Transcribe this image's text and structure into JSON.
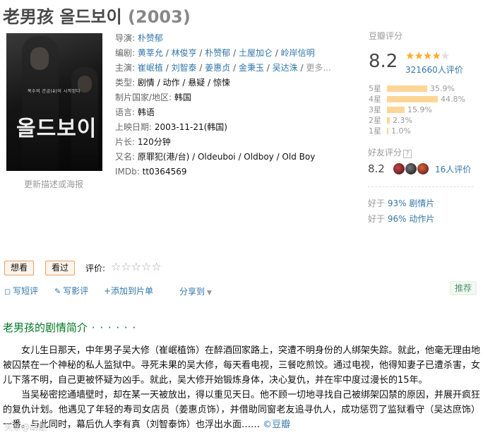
{
  "movie": {
    "title": "老男孩 올드보이",
    "year": "(2003)"
  },
  "poster": {
    "subtitle_text": "복수의 간금(ê)이 시작된다",
    "logo_text": "올드보이",
    "caption": "更新描述或海报"
  },
  "info": {
    "director_label": "导演:",
    "director": "朴赞郁",
    "writers_label": "编剧:",
    "writers": [
      "黄莘允",
      "林俊亨",
      "朴赞郁",
      "土屋加仑",
      "岭岸信明"
    ],
    "cast_label": "主演:",
    "cast": [
      "崔岷植",
      "刘智泰",
      "姜惠贞",
      "金秉玉",
      "吴达洙"
    ],
    "cast_more": "更多...",
    "genre_label": "类型:",
    "genre": "剧情 / 动作 / 悬疑 / 惊悚",
    "country_label": "制片国家/地区:",
    "country": "韩国",
    "language_label": "语言:",
    "language": "韩语",
    "release_label": "上映日期:",
    "release": "2003-11-21(韩国)",
    "runtime_label": "片长:",
    "runtime": "120分钟",
    "aka_label": "又名:",
    "aka": "原罪犯(港/台) / Oldeuboi / Oldboy / Old Boy",
    "imdb_label": "IMDb:",
    "imdb": "tt0364569"
  },
  "rating": {
    "header": "豆瓣评分",
    "score": "8.2",
    "stars_filled": 4,
    "stars_total": 5,
    "votes": "321660人评价",
    "distribution": [
      {
        "label": "5星",
        "pct": "35.9%",
        "value": 35.9
      },
      {
        "label": "4星",
        "pct": "44.8%",
        "value": 44.8
      },
      {
        "label": "3星",
        "pct": "15.9%",
        "value": 15.9
      },
      {
        "label": "2星",
        "pct": "2.3%",
        "value": 2.3
      },
      {
        "label": "1星",
        "pct": "1.0%",
        "value": 1.0
      }
    ]
  },
  "friends": {
    "header": "好友评分",
    "help": "?",
    "score": "8.2",
    "count": "16人评价"
  },
  "ranks": [
    {
      "prefix": "好于 ",
      "value": "93% 剧情片"
    },
    {
      "prefix": "好于 ",
      "value": "96% 动作片"
    }
  ],
  "controls": {
    "want": "想看",
    "watched": "看过",
    "rate_label": "评价:",
    "rate_stars": "☆☆☆☆☆",
    "write_review_short": "写短评",
    "write_review": "写影评",
    "add_to_list": "+添加到片单",
    "share": "分享到",
    "recommend": "推荐"
  },
  "synopsis": {
    "title": "老男孩的剧情简介",
    "title_dots": " · · · · · ·",
    "p1": "女儿生日那天，中年男子吴大修（崔岷植饰）在醉酒回家路上，突遭不明身份的人绑架失踪。就此，他毫无理由地被囚禁在一个神秘的私人监狱中。寻死未果的吴大修，每天看电视，三餐吃煎饺。通过电视，他得知妻子已遭杀害，女儿下落不明，自己更被怀疑为凶手。就此，吴大修开始锻炼身体，决心复仇，并在牢中度过漫长的15年。",
    "p2": "当吴秘密挖通墙壁时，却在某一天被放出，得以重见天日。他不顾一切地寻找自己被绑架囚禁的原因，并展开疯狂的复仇计划。他遇见了年轻的寿司女店员（姜惠贞饰），并借助同窗老友追寻仇人，成功惩罚了监狱看守（吴达庶饰）一番。与此同时，幕后仇人李有真（刘智泰饰）也浮出水面……",
    "source": "©豆瓣"
  },
  "watermark": "头条@胡楚"
}
